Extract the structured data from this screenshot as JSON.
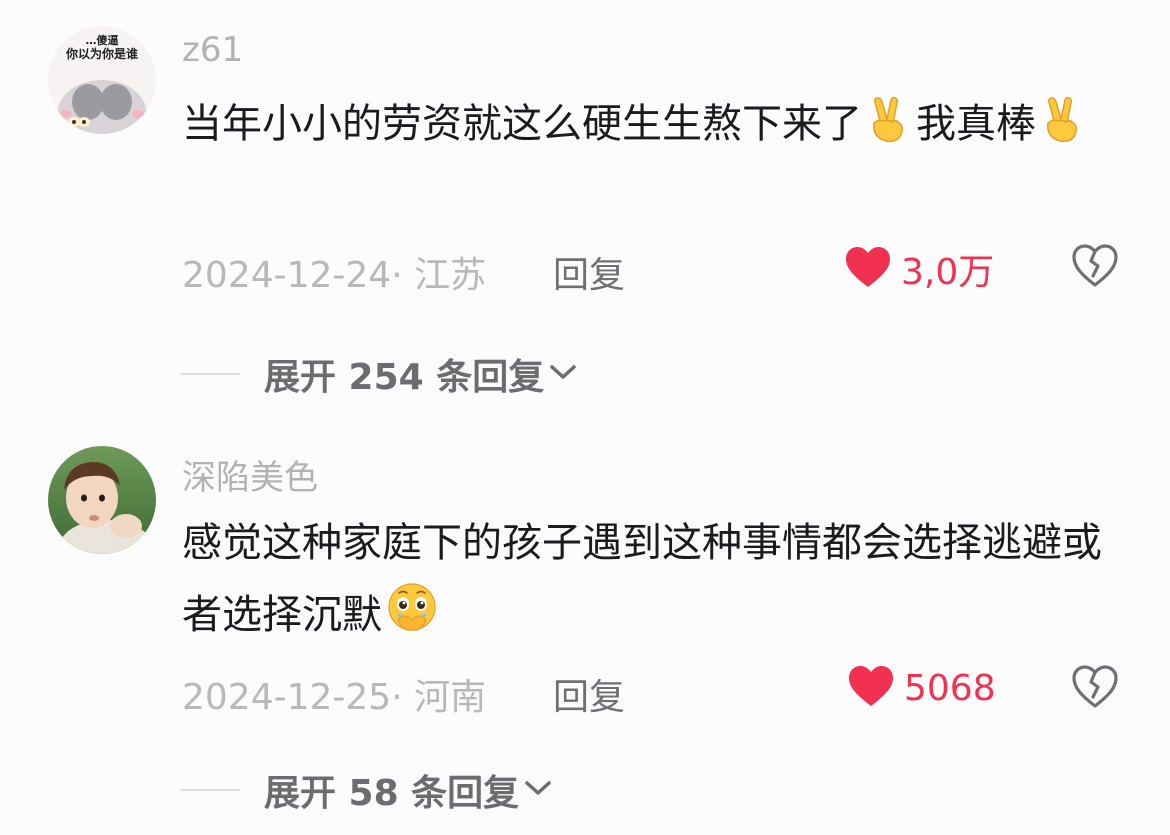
{
  "comments": [
    {
      "username": "z61",
      "avatar_caption_line1": "…傻逼",
      "avatar_caption_line2": "你以为你是谁",
      "text_part1": "当年小小的劳资就这么硬生生熬下来了",
      "text_part2": "我真棒",
      "emoji_name": "victory-hand",
      "date": "2024-12-24",
      "location": "江苏",
      "reply_label": "回复",
      "likes": "3,0万",
      "expand_label": "展开 254 条回复"
    },
    {
      "username": "深陷美色",
      "text": "感觉这种家庭下的孩子遇到这种事情都会选择逃避或者选择沉默",
      "emoji_name": "face-holding-back-tears",
      "date": "2024-12-25",
      "location": "河南",
      "reply_label": "回复",
      "likes": "5068",
      "expand_label": "展开 58 条回复"
    }
  ],
  "colors": {
    "background": "#fcfcfc",
    "username": "#b2b2b4",
    "body_text": "#1b1b1f",
    "meta_text": "#b8b8ba",
    "like_red": "#f2304f",
    "expand_text": "#6b6b70"
  },
  "icons": {
    "like": "heart-filled-icon",
    "dislike": "broken-heart-outline-icon",
    "expand": "chevron-down-icon"
  }
}
